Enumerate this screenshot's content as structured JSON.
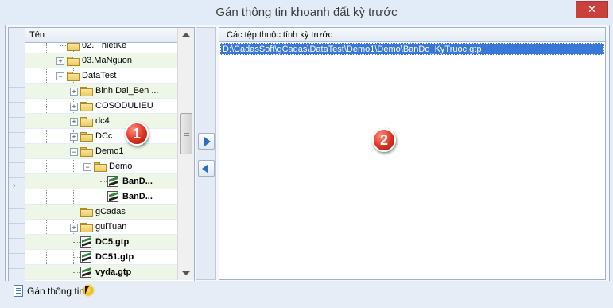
{
  "window": {
    "title": "Gán thông tin khoanh đất kỳ trước",
    "close_symbol": "✕"
  },
  "tree_panel": {
    "column_header": "Tên",
    "row_indicator_symbol": "›",
    "items": [
      {
        "label": "02. ThietKe",
        "expander": "",
        "icon": "folder-icon",
        "bold": false
      },
      {
        "label": "03.MaNguon",
        "expander": "+",
        "icon": "folder-icon",
        "bold": false
      },
      {
        "label": "DataTest",
        "expander": "−",
        "icon": "folder-open-icon",
        "bold": false
      },
      {
        "label": "Binh Dai_Ben ...",
        "expander": "+",
        "icon": "folder-icon",
        "bold": false
      },
      {
        "label": "COSODULIEU",
        "expander": "+",
        "icon": "folder-icon",
        "bold": false
      },
      {
        "label": "dc4",
        "expander": "+",
        "icon": "folder-icon",
        "bold": false
      },
      {
        "label": "DCc",
        "expander": "+",
        "icon": "folder-icon",
        "bold": false
      },
      {
        "label": "Demo1",
        "expander": "−",
        "icon": "folder-open-icon",
        "bold": false
      },
      {
        "label": "Demo",
        "expander": "−",
        "icon": "folder-open-icon",
        "bold": false
      },
      {
        "label": "BanD...",
        "expander": "",
        "icon": "gtp-file-icon",
        "bold": true
      },
      {
        "label": "BanD...",
        "expander": "",
        "icon": "gtp-file-icon",
        "bold": true
      },
      {
        "label": "gCadas",
        "expander": "",
        "icon": "folder-icon",
        "bold": false
      },
      {
        "label": "guiTuan",
        "expander": "+",
        "icon": "folder-icon",
        "bold": false
      },
      {
        "label": "DC5.gtp",
        "expander": "",
        "icon": "gtp-file-icon",
        "bold": true
      },
      {
        "label": "DC51.gtp",
        "expander": "",
        "icon": "gtp-file-icon",
        "bold": true
      },
      {
        "label": "vyda.gtp",
        "expander": "",
        "icon": "gtp-file-icon",
        "bold": true
      }
    ]
  },
  "transfer_buttons": {
    "add_icon": "arrow-right-icon",
    "remove_icon": "arrow-left-icon"
  },
  "file_list": {
    "column_header": "Các tệp thuộc tính kỳ trước",
    "rows": [
      "D:\\CadasSoft\\gCadas\\DataTest\\Demo1\\Demo\\BanDo_KyTruoc.gtp"
    ]
  },
  "badges": {
    "one": "1",
    "two": "2"
  },
  "footer": {
    "action_label": "Gán thông tin",
    "action_icon": "document-icon"
  },
  "colors": {
    "selection": "#3a78d8",
    "close_button": "#c9413b",
    "badge": "#d9321f",
    "accent_arrow": "#2d6fbf"
  }
}
